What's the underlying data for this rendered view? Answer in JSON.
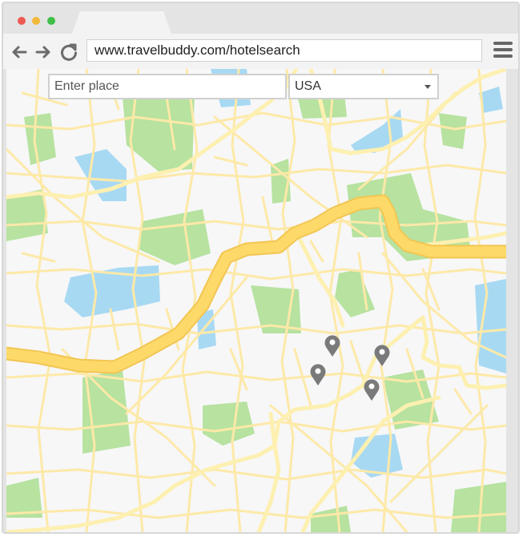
{
  "browser": {
    "url": "www.travelbuddy.com/hotelsearch",
    "window_controls": [
      "close",
      "minimize",
      "maximize"
    ],
    "icons": [
      "back-arrow-icon",
      "forward-arrow-icon",
      "reload-icon",
      "hamburger-menu-icon"
    ]
  },
  "search": {
    "place_placeholder": "Enter place",
    "place_value": "",
    "country_selected": "USA"
  },
  "map": {
    "hotel_markers": 4,
    "colors": {
      "background": "#f7f7f8",
      "road": "#fde9a8",
      "highway": "#fdd96a",
      "park": "#b7e2a0",
      "water": "#a8d9f3",
      "marker": "#7a7a7a"
    }
  }
}
